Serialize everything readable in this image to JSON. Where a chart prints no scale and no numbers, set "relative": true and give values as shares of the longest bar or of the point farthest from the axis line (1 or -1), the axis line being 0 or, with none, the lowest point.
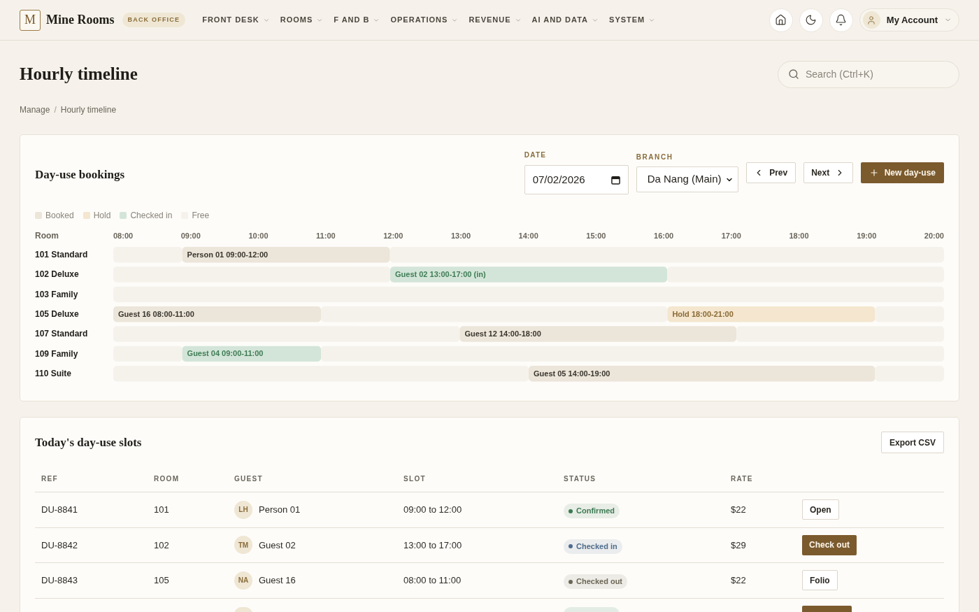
{
  "header": {
    "logo_letter": "M",
    "brand": "Mine Rooms",
    "badge": "BACK OFFICE",
    "nav": [
      "FRONT DESK",
      "ROOMS",
      "F AND B",
      "OPERATIONS",
      "REVENUE",
      "AI AND DATA",
      "SYSTEM"
    ],
    "account": "My Account"
  },
  "page": {
    "title": "Hourly timeline",
    "search": {
      "placeholder": "Search (Ctrl+K)"
    },
    "breadcrumb": {
      "items": [
        "Manage",
        "Hourly timeline"
      ],
      "separator": "/"
    }
  },
  "bookings_card": {
    "title": "Day-use bookings",
    "date": {
      "label": "DATE",
      "value": "07/02/2026"
    },
    "branch": {
      "label": "BRANCH",
      "value": "Da Nang (Main)"
    },
    "buttons": [
      {
        "label": "Prev",
        "kind": "prev"
      },
      {
        "label": "Next",
        "kind": "next"
      },
      {
        "label": "New day-use",
        "kind": "new"
      }
    ],
    "timeline": {
      "hours": [
        "08:00",
        "09:00",
        "10:00",
        "11:00",
        "12:00",
        "13:00",
        "14:00",
        "15:00",
        "16:00",
        "17:00",
        "18:00",
        "19:00",
        "20:00"
      ],
      "chart_data": {
        "type": "bar",
        "orientation": "horizontal",
        "stacked": true,
        "relative": true,
        "legend": "top",
        "ylabel": "Room",
        "categories": [
          "101 Standard",
          "102 Deluxe",
          "103 Family",
          "105 Deluxe",
          "107 Standard",
          "109 Family",
          "110 Suite"
        ],
        "xlim": [
          0,
          1
        ],
        "series": [
          {
            "color": "#f5f2ec",
            "values": [
              0.083,
              0.333,
              null,
              null,
              0.417,
              0.083,
              0.5
            ]
          },
          {
            "name": "Booked",
            "color": "#ece5da",
            "values": [
              0.25,
              null,
              null,
              0.25,
              0.333,
              null,
              0.417
            ]
          },
          {
            "name": "Checked in",
            "color": "#d3e5d8",
            "values": [
              null,
              0.333,
              null,
              null,
              null,
              0.167,
              null
            ]
          },
          {
            "color": "#f5f2ec",
            "values": [
              null,
              null,
              null,
              0.417,
              null,
              null,
              null
            ]
          },
          {
            "name": "Hold",
            "color": "#f4e6cf",
            "values": [
              null,
              null,
              null,
              0.25,
              null,
              null,
              null
            ]
          },
          {
            "name": "Free",
            "color": "#f5f2ec",
            "values": [
              0.667,
              0.333,
              1,
              0.083,
              0.25,
              0.75,
              0.083
            ]
          }
        ],
        "annotations": [
          "Person 01 09:00-12:00",
          "Guest 02 13:00-17:00 (in)",
          "Guest 16 08:00-11:00",
          "Hold 18:00-21:00",
          "Guest 12 14:00-18:00",
          "Guest 04 09:00-11:00",
          "Guest 05 14:00-19:00"
        ]
      }
    }
  },
  "slots_card": {
    "title": "Today's day-use slots",
    "export_button": "Export CSV",
    "columns": [
      "REF",
      "ROOM",
      "GUEST",
      "SLOT",
      "STATUS",
      "RATE"
    ],
    "rows": [
      {
        "kind": "full",
        "ref": "DU-8841",
        "room": "101",
        "guest": {
          "initials": "LH",
          "name": "Person 01"
        },
        "slot": "09:00 to 12:00",
        "status": {
          "label": "Confirmed",
          "color": "#3d7a52"
        },
        "rate": "$22",
        "action": {
          "label": "Open",
          "kind": "secondary"
        }
      },
      {
        "kind": "full",
        "ref": "DU-8842",
        "room": "102",
        "guest": {
          "initials": "TM",
          "name": "Guest 02"
        },
        "slot": "13:00 to 17:00",
        "status": {
          "label": "Checked in",
          "color": "#4e6c8e"
        },
        "rate": "$29",
        "action": {
          "label": "Check out",
          "kind": "primary"
        }
      },
      {
        "kind": "full",
        "ref": "DU-8843",
        "room": "105",
        "guest": {
          "initials": "NA",
          "name": "Guest 16"
        },
        "slot": "08:00 to 11:00",
        "status": {
          "label": "Checked out",
          "color": "#6b6656"
        },
        "rate": "$22",
        "action": {
          "label": "Folio",
          "kind": "secondary"
        }
      },
      {
        "kind": "cut",
        "status": {
          "color": "#e3ede5"
        },
        "action": {
          "kind": "primary"
        }
      }
    ]
  }
}
